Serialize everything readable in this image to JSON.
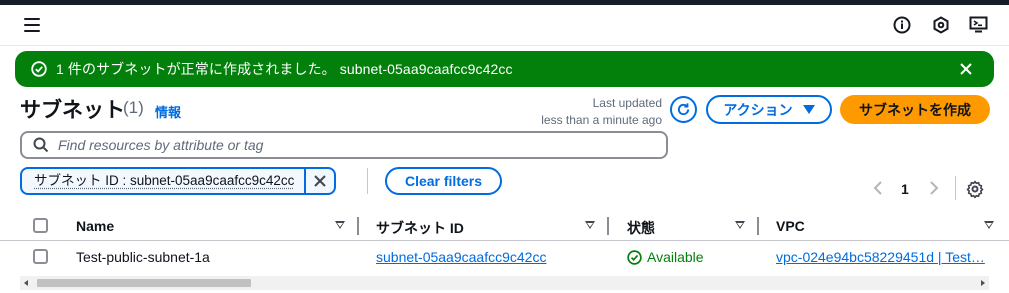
{
  "header": {
    "menu_icon": "hamburger-menu-icon",
    "right_icons": [
      "info-icon",
      "notifications-icon",
      "cloudshell-icon"
    ]
  },
  "flash": {
    "message": "1 件のサブネットが正常に作成されました。 subnet-05aa9caafcc9c42cc",
    "color": "#037f0c",
    "icon": "check-circle-icon"
  },
  "page": {
    "title": "サブネット",
    "count": "(1)",
    "info_link": "情報",
    "last_updated_label": "Last updated",
    "last_updated_value": "less than a minute ago",
    "actions_label": "アクション",
    "create_label": "サブネットを作成",
    "accent_color": "#006ce0",
    "primary_color": "#ff9900"
  },
  "search": {
    "placeholder": "Find resources by attribute or tag",
    "value": ""
  },
  "filters": {
    "token_label": "サブネット ID : subnet-05aa9caafcc9c42cc",
    "clear_label": "Clear filters"
  },
  "pagination": {
    "current_page": "1"
  },
  "table": {
    "columns": [
      "Name",
      "サブネット ID",
      "状態",
      "VPC"
    ],
    "rows": [
      {
        "name": "Test-public-subnet-1a",
        "subnet_id": "subnet-05aa9caafcc9c42cc",
        "state": "Available",
        "vpc": "vpc-024e94bc58229451d | Test…"
      }
    ]
  }
}
